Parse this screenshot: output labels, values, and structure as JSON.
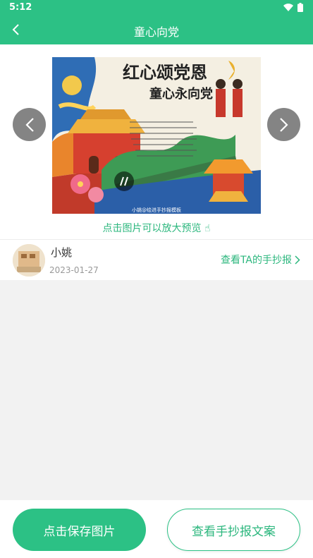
{
  "status_bar": {
    "time": "5:12"
  },
  "app_bar": {
    "title": "童心向党"
  },
  "preview": {
    "hint": "点击图片可以放大预览 ☝",
    "watermark": "小姚@绘进手抄报模板"
  },
  "poster": {
    "headline_1": "红心颂党恩",
    "headline_2": "童心永向党"
  },
  "author": {
    "name": "小姚",
    "date": "2023-01-27",
    "link_label": "查看TA的手抄报"
  },
  "actions": {
    "save_label": "点击保存图片",
    "copy_label": "查看手抄报文案"
  },
  "colors": {
    "accent": "#2cc185",
    "accent_text": "#2cb77e"
  }
}
